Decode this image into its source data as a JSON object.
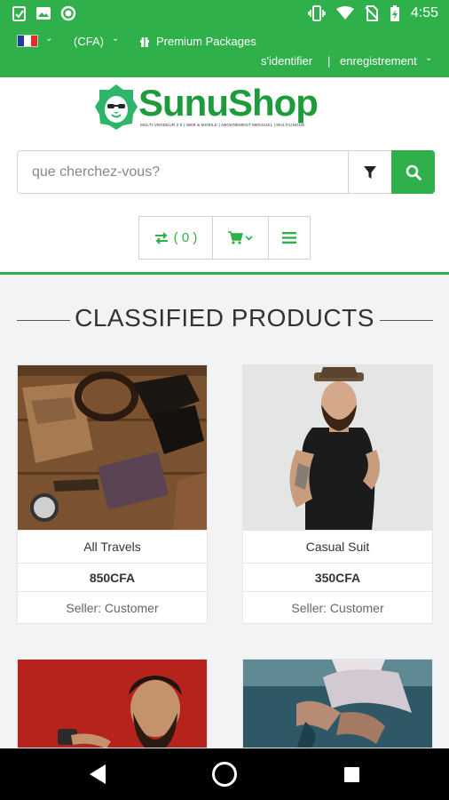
{
  "status_bar": {
    "time": "4:55",
    "icons": [
      "clipboard-check-icon",
      "image-icon",
      "circle-icon",
      "vibrate-icon",
      "wifi-icon",
      "no-sim-icon",
      "battery-charging-icon"
    ]
  },
  "top_bar": {
    "language_flag": "france-flag-icon",
    "currency": "(CFA)",
    "premium_label": "Premium Packages",
    "signin_label": "s'identifier",
    "separator": "|",
    "register_label": "enregistrement"
  },
  "brand": {
    "name": "SunuShop",
    "tagline": "MULTI-VENDEUR 2.0 | WEB & MOBILE | ABONNEMENT MENSUEL | MULTILINGUE",
    "color": "#1e9b3a"
  },
  "search": {
    "placeholder": "que cherchez-vous?",
    "value": ""
  },
  "toolbar": {
    "compare_count": "( 0 )"
  },
  "section": {
    "title": "CLASSIFIED PRODUCTS"
  },
  "products": [
    {
      "name": "All Travels",
      "price": "850CFA",
      "seller": "Seller: Customer"
    },
    {
      "name": "Casual Suit",
      "price": "350CFA",
      "seller": "Seller: Customer"
    }
  ],
  "colors": {
    "accent": "#2fb04a",
    "brand_dark": "#1e9b3a"
  }
}
